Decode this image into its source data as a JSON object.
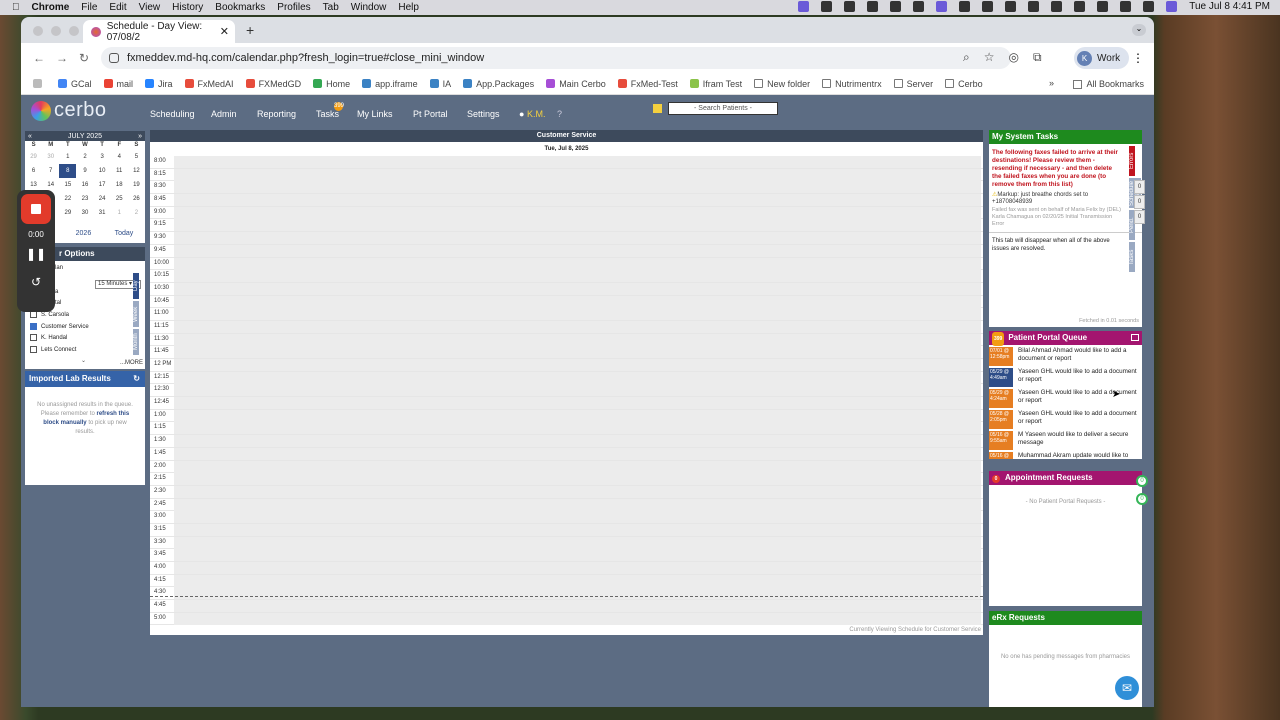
{
  "macmenu": {
    "app": "Chrome",
    "items": [
      "File",
      "Edit",
      "View",
      "History",
      "Bookmarks",
      "Profiles",
      "Tab",
      "Window",
      "Help"
    ],
    "clock": "Tue Jul 8  4:41 PM"
  },
  "browser": {
    "tab_title": "Schedule - Day View: 07/08/2",
    "url": "fxmeddev.md-hq.com/calendar.php?fresh_login=true#close_mini_window",
    "profile": "Work",
    "profile_initial": "K"
  },
  "bookmarks": [
    "GCal",
    "mail",
    "Jira",
    "FxMedAI",
    "FXMedGD",
    "Home",
    "app.iframe",
    "IA",
    "App.Packages",
    "Main Cerbo",
    "FxMed-Test",
    "Ifram Test",
    "New folder",
    "Nutrimentrx",
    "Server",
    "Cerbo"
  ],
  "all_bookmarks": "All Bookmarks",
  "more_bookmarks": "»",
  "app": {
    "logo": "cerbo",
    "nav": [
      "Scheduling",
      "Admin",
      "Reporting",
      "Tasks",
      "My Links",
      "Pt Portal",
      "Settings"
    ],
    "user": "K.M.",
    "help": "?",
    "tasks_badge": "399",
    "search_placeholder": "- Search Patients -"
  },
  "calendar": {
    "month": "JULY 2025",
    "prev": "«",
    "next": "»",
    "dow": [
      "S",
      "M",
      "T",
      "W",
      "T",
      "F",
      "S"
    ],
    "weeks": [
      [
        "29",
        "30",
        "1",
        "2",
        "3",
        "4",
        "5"
      ],
      [
        "6",
        "7",
        "8",
        "9",
        "10",
        "11",
        "12"
      ],
      [
        "13",
        "14",
        "15",
        "16",
        "17",
        "18",
        "19"
      ],
      [
        "20",
        "21",
        "22",
        "23",
        "24",
        "25",
        "26"
      ],
      [
        "27",
        "28",
        "29",
        "30",
        "31",
        "1",
        "2"
      ]
    ],
    "selected": "8",
    "years": [
      "2025",
      "2026",
      "Today"
    ]
  },
  "recorder": {
    "time": "0:00"
  },
  "schedule_options": {
    "title": "r Options",
    "duration": "15 Minutes",
    "first_partial": "lan",
    "partial_rows": [
      "a",
      "tal"
    ],
    "providers": [
      {
        "name": "S. Carsola",
        "checked": false
      },
      {
        "name": "Customer Service",
        "checked": true
      },
      {
        "name": "K. Handal",
        "checked": false
      },
      {
        "name": "Lets Connect",
        "checked": false
      }
    ],
    "more": "...MORE",
    "views": [
      "Day",
      "Week",
      "Month"
    ]
  },
  "lab_results": {
    "title": "Imported Lab Results",
    "text1": "No unassigned results in the queue. Please remember to",
    "link": "refresh this block manually",
    "text2": "to pick up new results."
  },
  "schedule": {
    "title": "Customer Service",
    "date": "Tue, Jul 8, 2025",
    "times": [
      "8:00",
      "8:15",
      "8:30",
      "8:45",
      "9:00",
      "9:15",
      "9:30",
      "9:45",
      "10:00",
      "10:15",
      "10:30",
      "10:45",
      "11:00",
      "11:15",
      "11:30",
      "11:45",
      "12 PM",
      "12:15",
      "12:30",
      "12:45",
      "1:00",
      "1:15",
      "1:30",
      "1:45",
      "2:00",
      "2:15",
      "2:30",
      "2:45",
      "3:00",
      "3:15",
      "3:30",
      "3:45",
      "4:00",
      "4:15",
      "4:30",
      "4:45",
      "5:00"
    ],
    "footer": "Currently Viewing Schedule for Customer Service"
  },
  "system_tasks": {
    "title": "My System Tasks",
    "error": "The following faxes failed to arrive at their destinations! Please review them - resending if necessary - and then delete the failed faxes when you are done (to remove them from this list)",
    "markup": "Markup: just breathe chords set to +18708048939",
    "failed": "Failed fax was sent on behalf of Maria Felix by (DEL) Karla Chamagua on 02/20/25 Initial Transmission Error",
    "note": "This tab will disappear when all of the above issues are resolved.",
    "fetched": "Fetched in 0.01 seconds",
    "side": [
      "Errors",
      "Schedule Alerts",
      "Pend.",
      "Tasks"
    ],
    "counts": [
      "0",
      "0",
      "0"
    ]
  },
  "portal_queue": {
    "title": "Patient Portal Queue",
    "badge": "399",
    "items": [
      {
        "date": "07/01 @ 12:58pm",
        "msg": "Bilal Ahmad Ahmad would like to add a document or report",
        "color": "o"
      },
      {
        "date": "05/29 @ 4:49am",
        "msg": "Yaseen GHL would like to add a document or report",
        "color": "b"
      },
      {
        "date": "05/29 @ 4:24am",
        "msg": "Yaseen GHL would like to add a document or report",
        "color": "o"
      },
      {
        "date": "05/28 @ 2:05pm",
        "msg": "Yaseen GHL would like to add a document or report",
        "color": "o"
      },
      {
        "date": "05/16 @ 9:55am",
        "msg": "M Yaseen would like to deliver a secure message",
        "color": "o"
      },
      {
        "date": "05/16 @",
        "msg": "Muhammad Akram update would like to",
        "color": "o"
      }
    ]
  },
  "appt_requests": {
    "title": "Appointment Requests",
    "badge": "0",
    "empty": "- No Patient Portal Requests -"
  },
  "erx": {
    "title": "eRx Requests",
    "empty": "No one has pending messages from pharmacies"
  },
  "bubbles": [
    "0",
    "0"
  ]
}
